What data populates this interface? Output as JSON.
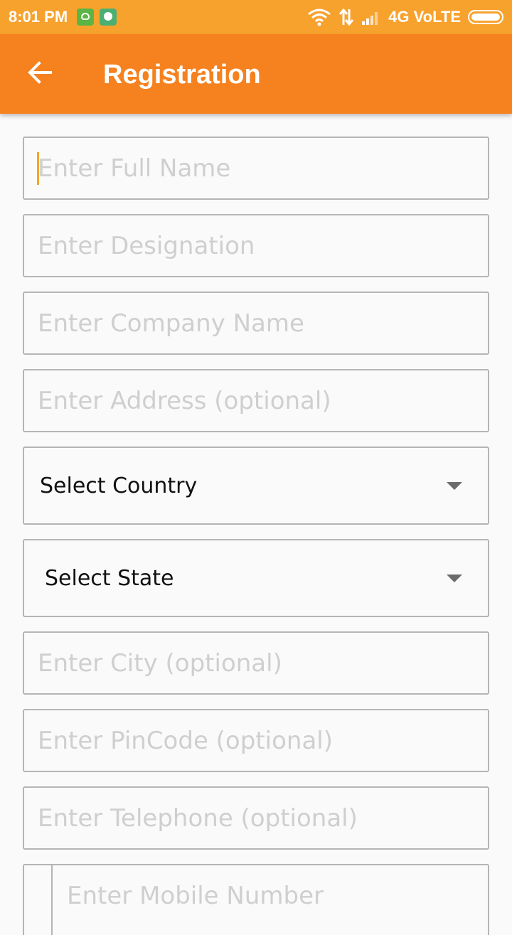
{
  "status_bar": {
    "time": "8:01 PM",
    "network": "4G VoLTE",
    "icons": [
      "notification-app-icon",
      "notification-chat-icon",
      "wifi-icon",
      "data-transfer-icon",
      "signal-icon",
      "battery-icon"
    ]
  },
  "app_bar": {
    "title": "Registration",
    "back_icon": "arrow-back-icon",
    "color": "#f5821f"
  },
  "form": {
    "full_name_placeholder": "Enter Full Name",
    "designation_placeholder": "Enter Designation",
    "company_placeholder": "Enter Company Name",
    "address_placeholder": "Enter Address (optional)",
    "country_select": "Select Country",
    "state_select": "Select State",
    "city_placeholder": "Enter City (optional)",
    "pincode_placeholder": "Enter PinCode (optional)",
    "telephone_placeholder": "Enter Telephone (optional)",
    "mobile_placeholder": "Enter Mobile Number"
  },
  "colors": {
    "status_bar": "#f8a22e",
    "accent": "#f5821f",
    "cursor": "#f5a623",
    "field_border": "#b5b5b5",
    "placeholder": "#cfcfcf"
  }
}
